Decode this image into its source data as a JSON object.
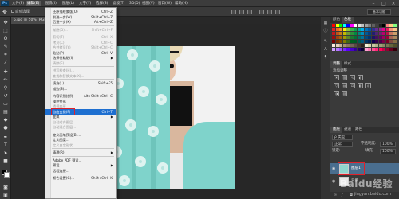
{
  "menubar": {
    "logo": "Ps",
    "items": [
      "文件(F)",
      "编辑(E)",
      "图像(I)",
      "图层(L)",
      "文字(Y)",
      "选择(S)",
      "滤镜(T)",
      "3D(D)",
      "视图(V)",
      "窗口(W)",
      "帮助(H)"
    ],
    "active_index": 1,
    "window_buttons": [
      "–",
      "□",
      "×"
    ]
  },
  "optionsbar": {
    "autoselect_label": "自动选择:",
    "workspace_label": "基本功能"
  },
  "document": {
    "tab_label": "5.jpg @ 50% (RGB/8)"
  },
  "edit_menu": {
    "items": [
      {
        "label": "还原描绘蒙版(O)",
        "shortcut": "Ctrl+Z",
        "disabled": false
      },
      {
        "label": "前进一步(W)",
        "shortcut": "Shift+Ctrl+Z",
        "disabled": false
      },
      {
        "label": "后退一步(K)",
        "shortcut": "Alt+Ctrl+Z",
        "disabled": false
      },
      {
        "sep": true
      },
      {
        "label": "渐隐(D)...",
        "shortcut": "Shift+Ctrl+F",
        "disabled": true
      },
      {
        "sep": true
      },
      {
        "label": "剪切(T)",
        "shortcut": "Ctrl+X",
        "disabled": true
      },
      {
        "label": "拷贝(C)",
        "shortcut": "Ctrl+C",
        "disabled": true
      },
      {
        "label": "合并拷贝(Y)",
        "shortcut": "Shift+Ctrl+C",
        "disabled": true
      },
      {
        "label": "粘贴(P)",
        "shortcut": "Ctrl+V",
        "disabled": false
      },
      {
        "label": "选择性粘贴(I)",
        "shortcut": "",
        "disabled": false,
        "submenu": true
      },
      {
        "label": "清除(E)",
        "shortcut": "",
        "disabled": true
      },
      {
        "sep": true
      },
      {
        "label": "拼写检查(H)...",
        "shortcut": "",
        "disabled": true
      },
      {
        "label": "查找和替换文本(X)...",
        "shortcut": "",
        "disabled": true
      },
      {
        "sep": true
      },
      {
        "label": "填充(L)...",
        "shortcut": "Shift+F5",
        "disabled": false
      },
      {
        "label": "描边(S)...",
        "shortcut": "",
        "disabled": false
      },
      {
        "sep": true
      },
      {
        "label": "内容识别比例",
        "shortcut": "Alt+Shift+Ctrl+C",
        "disabled": false
      },
      {
        "label": "操控变形",
        "shortcut": "",
        "disabled": false
      },
      {
        "label": "透视变形",
        "shortcut": "",
        "disabled": true
      },
      {
        "label": "自由变换(F)",
        "shortcut": "Ctrl+T",
        "disabled": false,
        "selected": true
      },
      {
        "label": "变换",
        "shortcut": "",
        "disabled": false,
        "submenu": true
      },
      {
        "label": "自动对齐图层...",
        "shortcut": "",
        "disabled": true
      },
      {
        "label": "自动混合图层...",
        "shortcut": "",
        "disabled": true
      },
      {
        "sep": true
      },
      {
        "label": "定义画笔预设(B)...",
        "shortcut": "",
        "disabled": false
      },
      {
        "label": "定义图案...",
        "shortcut": "",
        "disabled": false
      },
      {
        "label": "定义自定形状...",
        "shortcut": "",
        "disabled": true
      },
      {
        "sep": true
      },
      {
        "label": "清理(R)",
        "shortcut": "",
        "disabled": false,
        "submenu": true
      },
      {
        "sep": true
      },
      {
        "label": "Adobe PDF 预设...",
        "shortcut": "",
        "disabled": false
      },
      {
        "label": "预设",
        "shortcut": "",
        "disabled": false,
        "submenu": true
      },
      {
        "label": "远程连接...",
        "shortcut": "",
        "disabled": false
      },
      {
        "sep": true
      },
      {
        "label": "颜色设置(G)...",
        "shortcut": "Shift+Ctrl+K",
        "disabled": false
      }
    ]
  },
  "panels": {
    "color_tabs": [
      "颜色",
      "色板"
    ],
    "adjust_tabs": [
      "调整",
      "样式"
    ],
    "adjust_title": "添加调整",
    "layers_tabs": [
      "图层",
      "通道",
      "路径"
    ],
    "kind_label": "ρ 类型",
    "blend_mode": "正常",
    "opacity_label": "不透明度:",
    "opacity_value": "100%",
    "lock_label": "锁定:",
    "fill_label": "填充:",
    "fill_value": "100%",
    "layers": [
      {
        "name": "图层1",
        "selected": true
      },
      {
        "name": "背景",
        "selected": false
      }
    ]
  },
  "watermark": {
    "text": "Baidu经验",
    "url": "jingyan.baidu.com"
  },
  "colors": {
    "menu_highlight": "#1e6fd0",
    "highlight_box": "#e0202a",
    "layer_selected": "#4a6e8f"
  }
}
